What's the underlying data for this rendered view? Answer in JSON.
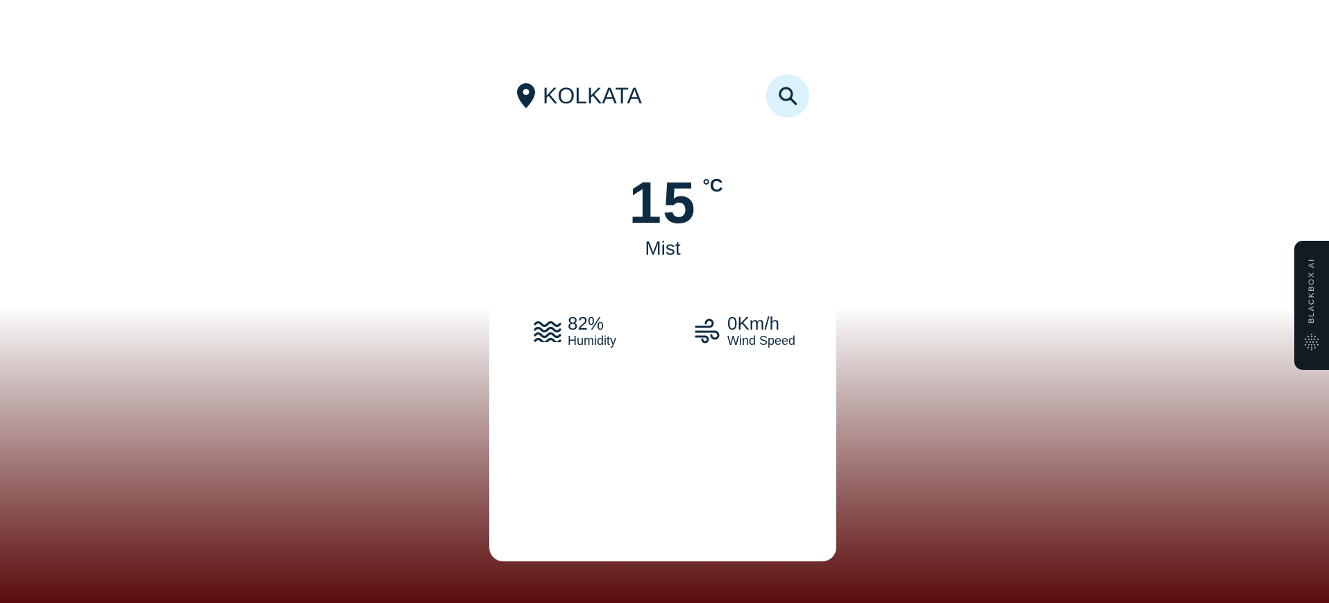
{
  "search": {
    "value": "Kolkata",
    "location_icon": "location-pin-icon",
    "search_icon": "magnifier-icon"
  },
  "weather": {
    "temperature": "15",
    "unit": "°C",
    "condition": "Mist"
  },
  "stats": {
    "humidity": {
      "value": "82%",
      "label": "Humidity",
      "icon": "waves-icon"
    },
    "wind": {
      "value": "0Km/h",
      "label": "Wind Speed",
      "icon": "wind-icon"
    }
  },
  "sidebar_widget": {
    "label": "BLACKBOX AI",
    "icon": "blackbox-dots-icon"
  },
  "colors": {
    "text": "#0d2b43",
    "search_button_bg": "#d9f2fb",
    "background_bottom": "#5a0c0c",
    "widget_bg": "#121a24"
  }
}
